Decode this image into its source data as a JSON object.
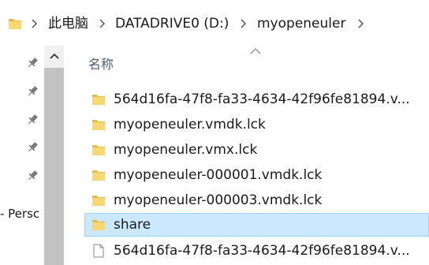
{
  "address": {
    "crumbs": [
      "此电脑",
      "DATADRIVE0 (D:)",
      "myopeneuler"
    ]
  },
  "nav": {
    "label": "- Persc"
  },
  "header": {
    "name_column": "名称"
  },
  "files": [
    {
      "name": "564d16fa-47f8-fa33-4634-42f96fe81894.v...",
      "type": "folder",
      "selected": false
    },
    {
      "name": "myopeneuler.vmdk.lck",
      "type": "folder",
      "selected": false
    },
    {
      "name": "myopeneuler.vmx.lck",
      "type": "folder",
      "selected": false
    },
    {
      "name": "myopeneuler-000001.vmdk.lck",
      "type": "folder",
      "selected": false
    },
    {
      "name": "myopeneuler-000003.vmdk.lck",
      "type": "folder",
      "selected": false
    },
    {
      "name": "share",
      "type": "folder",
      "selected": true
    },
    {
      "name": "564d16fa-47f8-fa33-4634-42f96fe81894.v...",
      "type": "file",
      "selected": false
    }
  ],
  "colors": {
    "folder": "#f8d775",
    "folder_dark": "#e8b84a",
    "selection": "#cce8ff",
    "selection_border": "#99d1ff",
    "header_text": "#4c607a"
  }
}
